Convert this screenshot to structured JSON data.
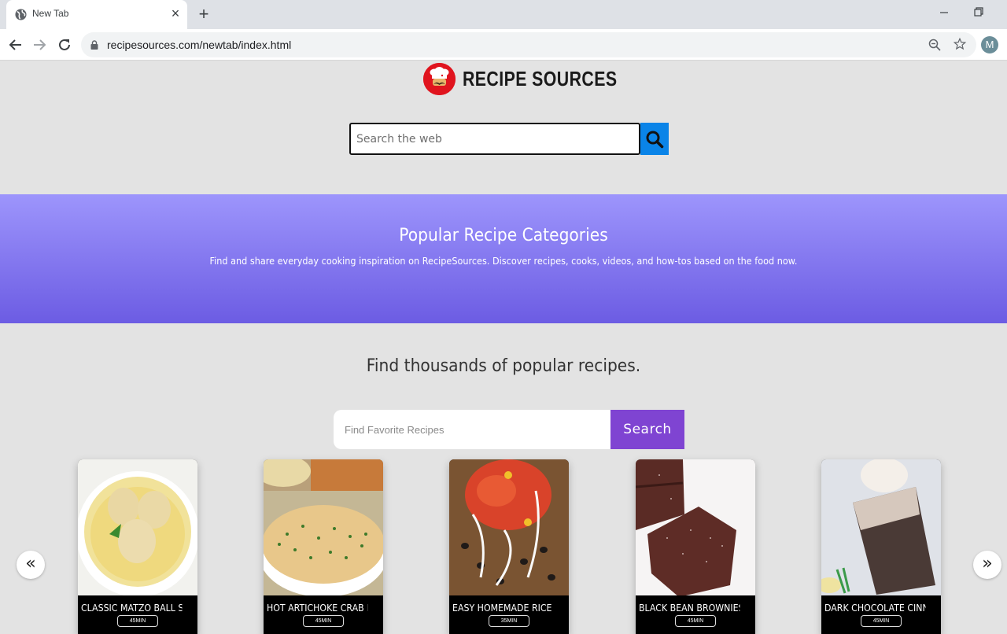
{
  "browser": {
    "tab_title": "New Tab",
    "url": "recipesources.com/newtab/index.html",
    "profile_initial": "M",
    "icons": {
      "tab_favicon": "globe-icon",
      "tab_close": "close-icon",
      "new_tab": "plus-icon",
      "back": "arrow-left-icon",
      "forward": "arrow-right-icon",
      "reload": "reload-icon",
      "lock": "lock-icon",
      "zoom": "zoom-out-icon",
      "bookmark": "star-icon",
      "minimize": "minimize-icon",
      "restore": "restore-icon"
    },
    "glyphs": {
      "close": "×",
      "new_tab": "+"
    }
  },
  "header": {
    "brand": "RECIPE SOURCES",
    "logo_icon": "chef-hat-icon",
    "web_search": {
      "placeholder": "Search the web",
      "value": "",
      "button_icon": "search-icon"
    }
  },
  "banner": {
    "title": "Popular Recipe Categories",
    "subtitle": "Find and share everyday cooking inspiration on RecipeSources. Discover recipes, cooks, videos, and how-tos based on the food now."
  },
  "main": {
    "tagline": "Find thousands of popular recipes.",
    "recipe_search": {
      "placeholder": "Find Favorite Recipes",
      "value": "",
      "button_label": "Search"
    },
    "carousel": {
      "prev_glyph": "«",
      "next_glyph": "»",
      "cards": [
        {
          "name": "CLASSIC MATZO BALL SOUP",
          "time": "45MIN"
        },
        {
          "name": "HOT ARTICHOKE CRAB DIP",
          "time": "45MIN"
        },
        {
          "name": "EASY HOMEMADE RICE AND BEANS",
          "time": "35MIN"
        },
        {
          "name": "BLACK BEAN BROWNIES",
          "time": "45MIN"
        },
        {
          "name": "DARK CHOCOLATE CINNAMON",
          "time": "45MIN"
        }
      ]
    }
  },
  "colors": {
    "search_button": "#0a84e8",
    "recipe_search_button": "#7f44d2",
    "banner_top": "#9d95fc",
    "banner_bottom": "#6c5ce3",
    "logo_red": "#e0141e"
  }
}
